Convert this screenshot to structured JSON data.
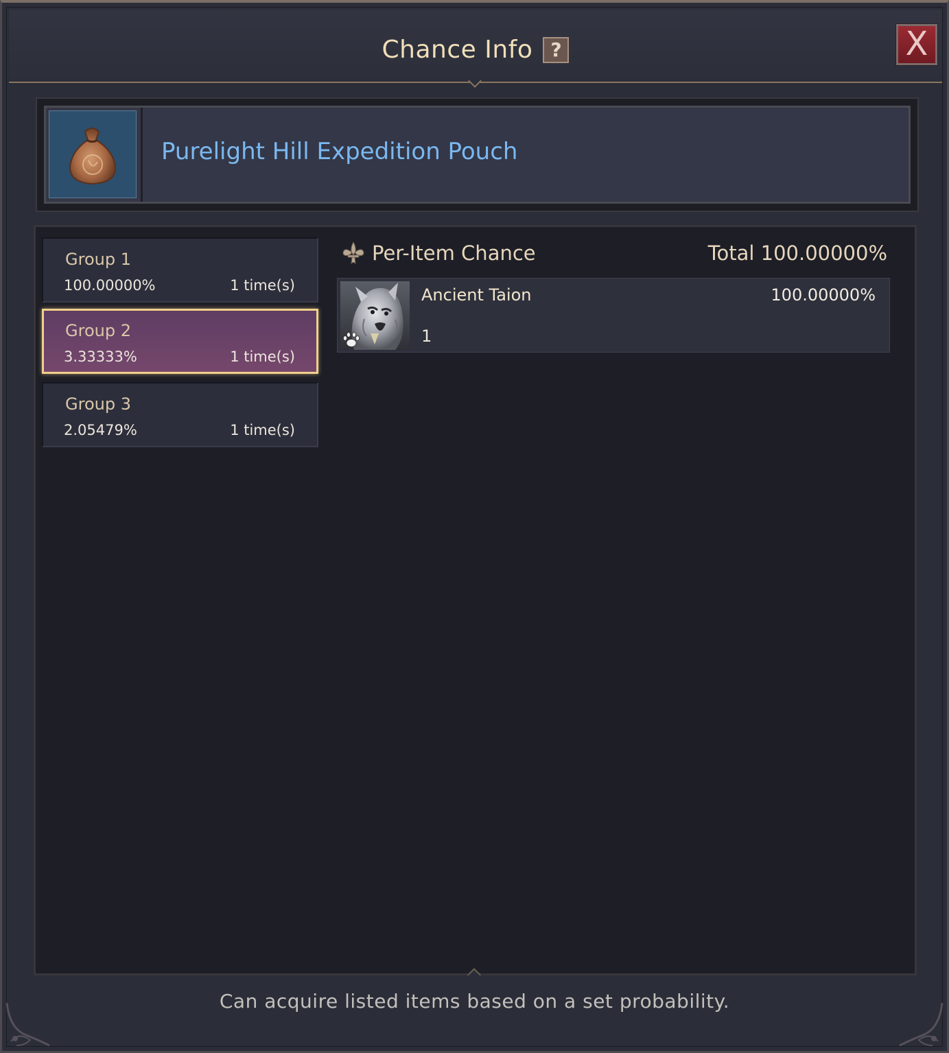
{
  "window": {
    "title": "Chance Info",
    "help_label": "?",
    "close_label": "X"
  },
  "item": {
    "name": "Purelight Hill Expedition Pouch",
    "icon": "pouch-icon"
  },
  "groups": [
    {
      "name": "Group 1",
      "chance": "100.00000%",
      "times": "1 time(s)",
      "selected": false
    },
    {
      "name": "Group 2",
      "chance": "3.33333%",
      "times": "1 time(s)",
      "selected": true
    },
    {
      "name": "Group 3",
      "chance": "2.05479%",
      "times": "1 time(s)",
      "selected": false
    }
  ],
  "per_item": {
    "title": "Per-Item Chance",
    "icon": "fleur-de-lis-icon",
    "total": "Total 100.00000%",
    "items": [
      {
        "name": "Ancient Taion",
        "quantity": "1",
        "chance": "100.00000%",
        "type_icon": "paw-icon"
      }
    ]
  },
  "footer": {
    "note": "Can acquire listed items based on a set probability."
  },
  "colors": {
    "item_name": "#7ab8f0",
    "selected_border": "#f0cf8c",
    "selected_bg": "#6a4268",
    "close_button": "#8a2430"
  }
}
